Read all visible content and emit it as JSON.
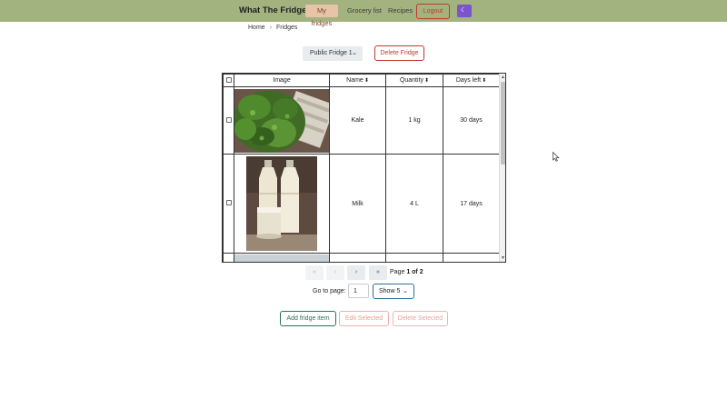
{
  "navbar": {
    "brand": "What The Fridge",
    "links": [
      "My fridges",
      "Grocery list",
      "Recipes"
    ],
    "logout_label": "Logout",
    "theme_icon": "moon-icon",
    "bg_color": "#a3b37f"
  },
  "breadcrumb": {
    "home": "Home",
    "current": "Fridges"
  },
  "fridge_select": {
    "value": "Public Fridge 1"
  },
  "delete_fridge_label": "Delete Fridge",
  "table": {
    "headers": {
      "image": "Image",
      "name": "Name",
      "quantity": "Quantity",
      "days_left": "Days left"
    },
    "rows": [
      {
        "image": "kale",
        "name": "Kale",
        "quantity": "1 kg",
        "days_left": "30 days"
      },
      {
        "image": "milk",
        "name": "Milk",
        "quantity": "4 L",
        "days_left": "17 days"
      }
    ]
  },
  "pagination": {
    "first": "«",
    "prev": "‹",
    "next": "›",
    "last": "»",
    "page_word": "Page",
    "page_of": "1 of 2",
    "goto_label": "Go to page:",
    "goto_value": "1",
    "show_value": "Show 5"
  },
  "actions": {
    "add": "Add fridge item",
    "edit": "Edit Selected",
    "delete": "Delete Selected"
  }
}
